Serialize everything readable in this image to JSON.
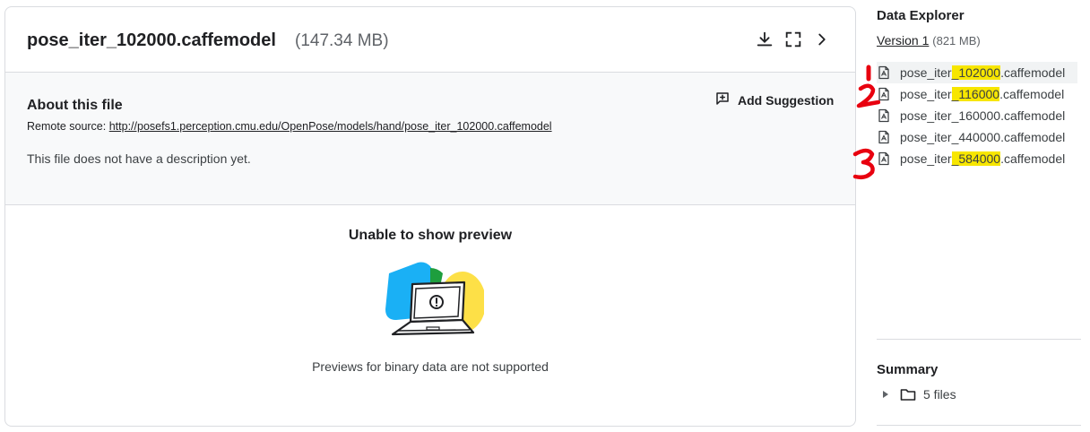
{
  "file": {
    "name": "pose_iter_102000.caffemodel",
    "size": "(147.34 MB)"
  },
  "about": {
    "title": "About this file",
    "add_suggestion": "Add Suggestion",
    "remote_label": "Remote source:",
    "remote_url": "http://posefs1.perception.cmu.edu/OpenPose/models/hand/pose_iter_102000.caffemodel",
    "description": "This file does not have a description yet."
  },
  "preview": {
    "title": "Unable to show preview",
    "message": "Previews for binary data are not supported"
  },
  "explorer": {
    "title": "Data Explorer",
    "version_label": "Version 1",
    "version_size": "(821 MB)",
    "files": [
      {
        "pre": "pose_iter",
        "hl": "_102000",
        "post": ".caffemodel",
        "active": true
      },
      {
        "pre": "pose_iter",
        "hl": "_116000",
        "post": ".caffemodel",
        "active": false
      },
      {
        "pre": "pose_iter_160000.caffemodel",
        "hl": "",
        "post": "",
        "active": false
      },
      {
        "pre": "pose_iter_440000.caffemodel",
        "hl": "",
        "post": "",
        "active": false
      },
      {
        "pre": "pose_iter",
        "hl": "_584000",
        "post": ".caffemodel",
        "active": false
      }
    ]
  },
  "summary": {
    "title": "Summary",
    "files_label": "5 files"
  },
  "annotations": {
    "labels": [
      "1",
      "2",
      "3"
    ],
    "color": "#e8000f"
  },
  "icons": {
    "download": "download-icon",
    "fullscreen": "fullscreen-icon",
    "next": "chevron-right-icon",
    "suggestion": "add-comment-icon",
    "file": "file-icon",
    "folder": "folder-icon",
    "expand": "triangle-right-icon"
  },
  "colors": {
    "highlight": "#f7e600",
    "border": "#dadce0",
    "about_bg": "#f8f9fa"
  }
}
